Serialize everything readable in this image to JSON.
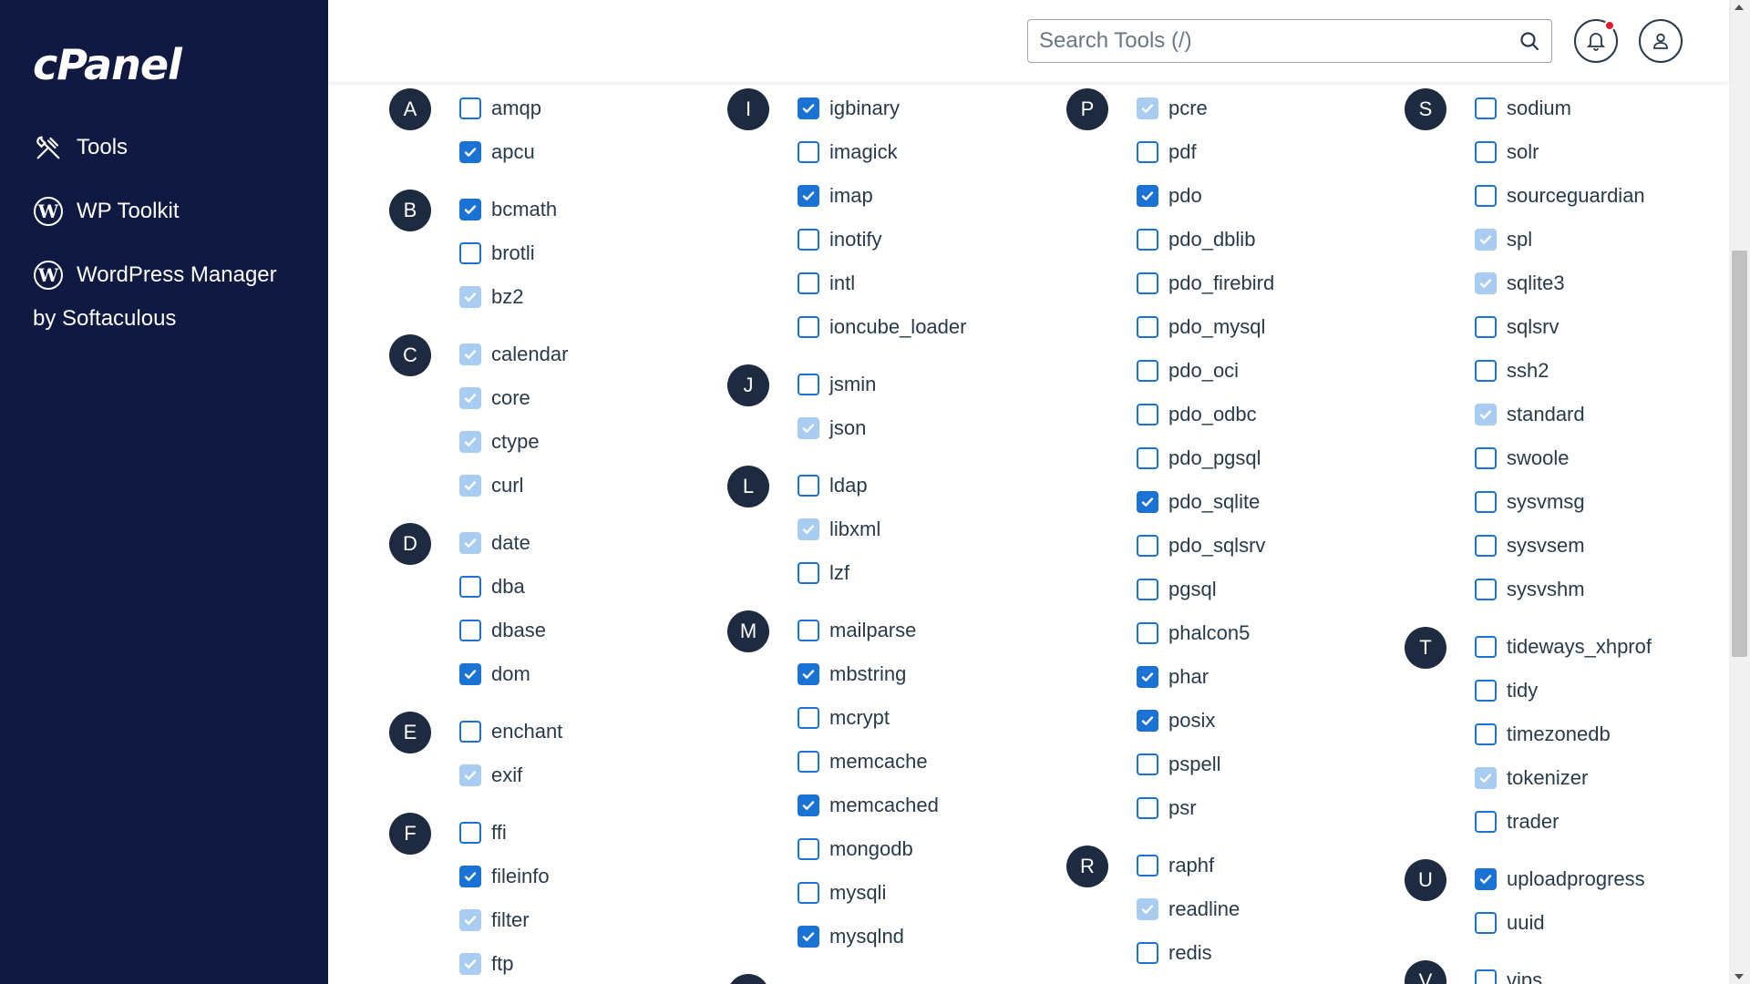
{
  "app": {
    "logo_text": "cPanel"
  },
  "sidebar": {
    "items": [
      {
        "label": "Tools",
        "icon": "tools-icon"
      },
      {
        "label": "WP Toolkit",
        "icon": "wordpress-icon"
      },
      {
        "label": "WordPress Manager",
        "icon": "wordpress-icon"
      }
    ],
    "wp_manager_sub": "by Softaculous"
  },
  "header": {
    "search_placeholder": "Search Tools (/)",
    "notifications_icon": "bell-icon",
    "user_icon": "user-icon"
  },
  "colors": {
    "sidebar_bg": "#0f1941",
    "checkbox_blue": "#1a73d4",
    "checkbox_disabled": "#a9cdf0",
    "badge_bg": "#1d2a3f",
    "notification_dot": "#e11d2e"
  },
  "columns": [
    {
      "groups": [
        {
          "letter": "A",
          "items": [
            {
              "name": "amqp",
              "state": "unchecked"
            },
            {
              "name": "apcu",
              "state": "checked"
            }
          ]
        },
        {
          "letter": "B",
          "items": [
            {
              "name": "bcmath",
              "state": "checked"
            },
            {
              "name": "brotli",
              "state": "unchecked"
            },
            {
              "name": "bz2",
              "state": "disabled"
            }
          ]
        },
        {
          "letter": "C",
          "items": [
            {
              "name": "calendar",
              "state": "disabled"
            },
            {
              "name": "core",
              "state": "disabled"
            },
            {
              "name": "ctype",
              "state": "disabled"
            },
            {
              "name": "curl",
              "state": "disabled"
            }
          ]
        },
        {
          "letter": "D",
          "items": [
            {
              "name": "date",
              "state": "disabled"
            },
            {
              "name": "dba",
              "state": "unchecked"
            },
            {
              "name": "dbase",
              "state": "unchecked"
            },
            {
              "name": "dom",
              "state": "checked"
            }
          ]
        },
        {
          "letter": "E",
          "items": [
            {
              "name": "enchant",
              "state": "unchecked"
            },
            {
              "name": "exif",
              "state": "disabled"
            }
          ]
        },
        {
          "letter": "F",
          "items": [
            {
              "name": "ffi",
              "state": "unchecked"
            },
            {
              "name": "fileinfo",
              "state": "checked"
            },
            {
              "name": "filter",
              "state": "disabled"
            },
            {
              "name": "ftp",
              "state": "disabled"
            }
          ]
        }
      ]
    },
    {
      "groups": [
        {
          "letter": "I",
          "items": [
            {
              "name": "igbinary",
              "state": "checked"
            },
            {
              "name": "imagick",
              "state": "unchecked"
            },
            {
              "name": "imap",
              "state": "checked"
            },
            {
              "name": "inotify",
              "state": "unchecked"
            },
            {
              "name": "intl",
              "state": "unchecked"
            },
            {
              "name": "ioncube_loader",
              "state": "unchecked"
            }
          ]
        },
        {
          "letter": "J",
          "items": [
            {
              "name": "jsmin",
              "state": "unchecked"
            },
            {
              "name": "json",
              "state": "disabled"
            }
          ]
        },
        {
          "letter": "L",
          "items": [
            {
              "name": "ldap",
              "state": "unchecked"
            },
            {
              "name": "libxml",
              "state": "disabled"
            },
            {
              "name": "lzf",
              "state": "unchecked"
            }
          ]
        },
        {
          "letter": "M",
          "items": [
            {
              "name": "mailparse",
              "state": "unchecked"
            },
            {
              "name": "mbstring",
              "state": "checked"
            },
            {
              "name": "mcrypt",
              "state": "unchecked"
            },
            {
              "name": "memcache",
              "state": "unchecked"
            },
            {
              "name": "memcached",
              "state": "checked"
            },
            {
              "name": "mongodb",
              "state": "unchecked"
            },
            {
              "name": "mysqli",
              "state": "unchecked"
            },
            {
              "name": "mysqlnd",
              "state": "checked"
            }
          ]
        },
        {
          "letter": "",
          "items": []
        }
      ]
    },
    {
      "groups": [
        {
          "letter": "P",
          "items": [
            {
              "name": "pcre",
              "state": "disabled"
            },
            {
              "name": "pdf",
              "state": "unchecked"
            },
            {
              "name": "pdo",
              "state": "checked"
            },
            {
              "name": "pdo_dblib",
              "state": "unchecked"
            },
            {
              "name": "pdo_firebird",
              "state": "unchecked"
            },
            {
              "name": "pdo_mysql",
              "state": "unchecked"
            },
            {
              "name": "pdo_oci",
              "state": "unchecked"
            },
            {
              "name": "pdo_odbc",
              "state": "unchecked"
            },
            {
              "name": "pdo_pgsql",
              "state": "unchecked"
            },
            {
              "name": "pdo_sqlite",
              "state": "checked"
            },
            {
              "name": "pdo_sqlsrv",
              "state": "unchecked"
            },
            {
              "name": "pgsql",
              "state": "unchecked"
            },
            {
              "name": "phalcon5",
              "state": "unchecked"
            },
            {
              "name": "phar",
              "state": "checked"
            },
            {
              "name": "posix",
              "state": "checked"
            },
            {
              "name": "pspell",
              "state": "unchecked"
            },
            {
              "name": "psr",
              "state": "unchecked"
            }
          ]
        },
        {
          "letter": "R",
          "items": [
            {
              "name": "raphf",
              "state": "unchecked"
            },
            {
              "name": "readline",
              "state": "disabled"
            },
            {
              "name": "redis",
              "state": "unchecked"
            }
          ]
        }
      ]
    },
    {
      "groups": [
        {
          "letter": "S",
          "items": [
            {
              "name": "sodium",
              "state": "unchecked"
            },
            {
              "name": "solr",
              "state": "unchecked"
            },
            {
              "name": "sourceguardian",
              "state": "unchecked"
            },
            {
              "name": "spl",
              "state": "disabled"
            },
            {
              "name": "sqlite3",
              "state": "disabled"
            },
            {
              "name": "sqlsrv",
              "state": "unchecked"
            },
            {
              "name": "ssh2",
              "state": "unchecked"
            },
            {
              "name": "standard",
              "state": "disabled"
            },
            {
              "name": "swoole",
              "state": "unchecked"
            },
            {
              "name": "sysvmsg",
              "state": "unchecked"
            },
            {
              "name": "sysvsem",
              "state": "unchecked"
            },
            {
              "name": "sysvshm",
              "state": "unchecked"
            }
          ]
        },
        {
          "letter": "T",
          "items": [
            {
              "name": "tideways_xhprof",
              "state": "unchecked"
            },
            {
              "name": "tidy",
              "state": "unchecked"
            },
            {
              "name": "timezonedb",
              "state": "unchecked"
            },
            {
              "name": "tokenizer",
              "state": "disabled"
            },
            {
              "name": "trader",
              "state": "unchecked"
            }
          ]
        },
        {
          "letter": "U",
          "items": [
            {
              "name": "uploadprogress",
              "state": "checked"
            },
            {
              "name": "uuid",
              "state": "unchecked"
            }
          ]
        },
        {
          "letter": "V",
          "items": [
            {
              "name": "vips",
              "state": "unchecked"
            }
          ]
        }
      ]
    }
  ]
}
